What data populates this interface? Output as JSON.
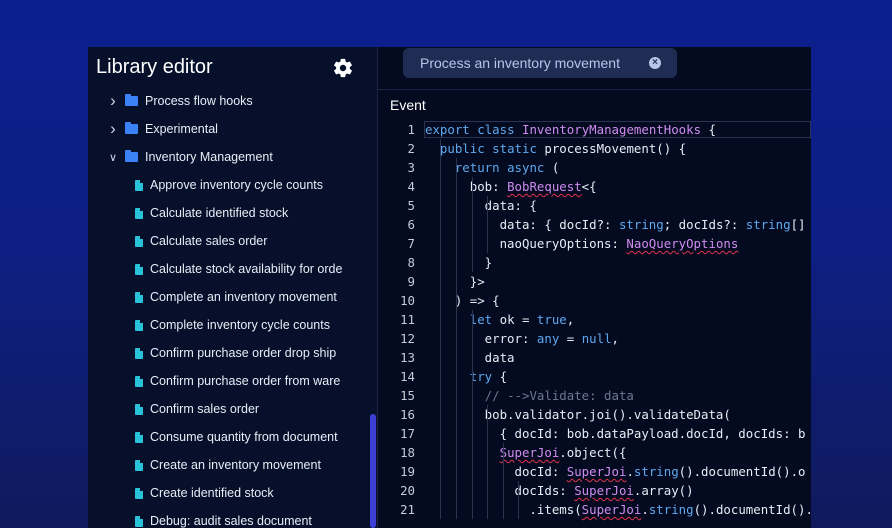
{
  "sidebar": {
    "title": "Library editor",
    "settings_icon": "gear-icon",
    "items": [
      {
        "label": "Process flow hooks",
        "kind": "folder",
        "expanded": false
      },
      {
        "label": "Experimental",
        "kind": "folder",
        "expanded": false
      },
      {
        "label": "Inventory Management",
        "kind": "folder",
        "expanded": true
      },
      {
        "label": "Approve inventory cycle counts",
        "kind": "file"
      },
      {
        "label": "Calculate identified stock",
        "kind": "file"
      },
      {
        "label": "Calculate sales order",
        "kind": "file"
      },
      {
        "label": "Calculate stock availability for orde",
        "kind": "file"
      },
      {
        "label": "Complete an inventory movement",
        "kind": "file"
      },
      {
        "label": "Complete inventory cycle counts",
        "kind": "file"
      },
      {
        "label": "Confirm purchase order drop ship",
        "kind": "file"
      },
      {
        "label": "Confirm purchase order from ware",
        "kind": "file"
      },
      {
        "label": "Confirm sales order",
        "kind": "file"
      },
      {
        "label": "Consume quantity from document",
        "kind": "file"
      },
      {
        "label": "Create an inventory movement",
        "kind": "file"
      },
      {
        "label": "Create identified stock",
        "kind": "file"
      },
      {
        "label": "Debug: audit sales document",
        "kind": "file"
      }
    ]
  },
  "tab": {
    "label": "Process an inventory movement",
    "close_icon": "close-icon"
  },
  "section_label": "Event",
  "colors": {
    "accent": "#3d3fd6",
    "folder": "#3b82f6",
    "file": "#28c3d8",
    "keyword": "#5fa8ee",
    "type": "#cf8cf0",
    "comment": "#6b7890",
    "error_squiggle": "#e0334a"
  },
  "editor": {
    "lines": [
      {
        "n": "1",
        "code": "export class InventoryManagementHooks {"
      },
      {
        "n": "2",
        "code": "  public static processMovement() {"
      },
      {
        "n": "3",
        "code": "    return async ("
      },
      {
        "n": "4",
        "code": "      bob: BobRequest<{"
      },
      {
        "n": "5",
        "code": "        data: {"
      },
      {
        "n": "6",
        "code": "          data: { docId?: string; docIds?: string[]"
      },
      {
        "n": "7",
        "code": "          naoQueryOptions: NaoQueryOptions"
      },
      {
        "n": "8",
        "code": "        }"
      },
      {
        "n": "9",
        "code": "      }>"
      },
      {
        "n": "10",
        "code": "    ) => {"
      },
      {
        "n": "11",
        "code": "      let ok = true,"
      },
      {
        "n": "12",
        "code": "        error: any = null,"
      },
      {
        "n": "13",
        "code": "        data"
      },
      {
        "n": "14",
        "code": "      try {"
      },
      {
        "n": "15",
        "code": "        // -->Validate: data"
      },
      {
        "n": "16",
        "code": "        bob.validator.joi().validateData("
      },
      {
        "n": "17",
        "code": "          { docId: bob.dataPayload.docId, docIds: b"
      },
      {
        "n": "18",
        "code": "          SuperJoi.object({"
      },
      {
        "n": "19",
        "code": "            docId: SuperJoi.string().documentId().o"
      },
      {
        "n": "20",
        "code": "            docIds: SuperJoi.array()"
      },
      {
        "n": "21",
        "code": "              .items(SuperJoi.string().documentId()."
      }
    ]
  }
}
